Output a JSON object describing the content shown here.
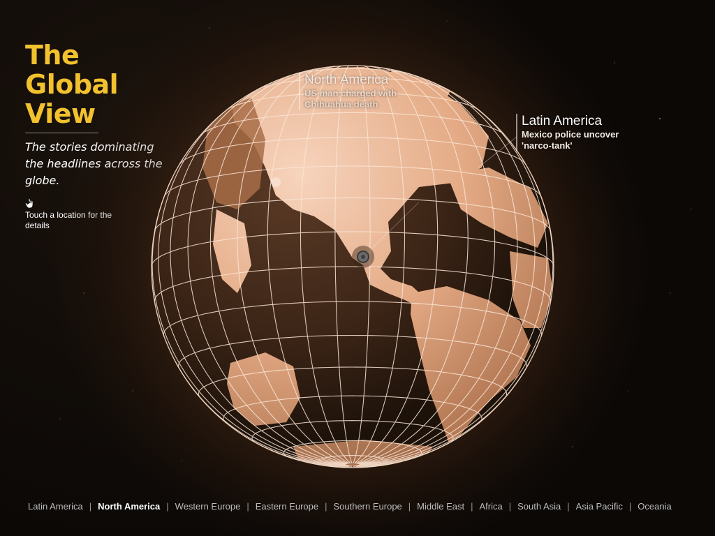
{
  "title_lines": [
    "The",
    "Global",
    "View"
  ],
  "subtitle": "The stories dominating the headlines across the globe.",
  "hint": {
    "icon": "hand-pointer-icon",
    "text": "Touch a location for the details"
  },
  "callouts": {
    "north_america": {
      "region": "North America",
      "headline": "US man charged with Chihuahua death"
    },
    "latin_america": {
      "region": "Latin America",
      "headline": "Mexico police uncover 'narco-tank'"
    }
  },
  "nav": {
    "active": "North America",
    "items": [
      "Latin America",
      "North America",
      "Western Europe",
      "Eastern Europe",
      "Southern Europe",
      "Middle East",
      "Africa",
      "South Asia",
      "Asia Pacific",
      "Oceania"
    ]
  },
  "colors": {
    "title": "#f2c12e",
    "background": "#0b0806",
    "globe_land": "#e9b796",
    "globe_grid": "#fbe6d6",
    "nav_text": "#bdbdbd",
    "nav_active": "#ffffff"
  }
}
